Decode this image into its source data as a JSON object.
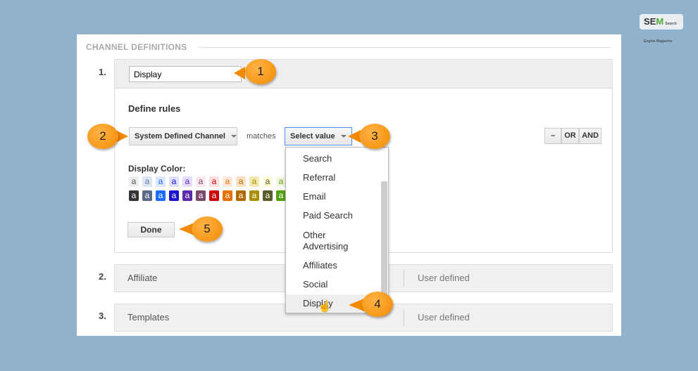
{
  "logo": {
    "brand": "SEM",
    "sub": "Search Engine Magazine"
  },
  "section_title": "CHANNEL DEFINITIONS",
  "rows": [
    {
      "number": "1.",
      "name": "Display"
    },
    {
      "number": "2.",
      "name": "Affiliate",
      "type": "User defined"
    },
    {
      "number": "3.",
      "name": "Templates",
      "type": "User defined"
    }
  ],
  "rules": {
    "title": "Define rules",
    "dimension": "System Defined Channel",
    "operator": "matches",
    "value_placeholder": "Select value",
    "minus": "–",
    "or": "OR",
    "and": "AND"
  },
  "display_color": {
    "label": "Display Color:",
    "swatch_letter": "a",
    "light": [
      [
        "#eeeeee",
        "#555"
      ],
      [
        "#dde6f2",
        "#6a7a96"
      ],
      [
        "#dde8ff",
        "#1a6cff"
      ],
      [
        "#dde0ff",
        "#1a12cc"
      ],
      [
        "#e4dcff",
        "#5a2aa8"
      ],
      [
        "#fbe8ee",
        "#7a4a6a"
      ],
      [
        "#fde0e0",
        "#cc0000"
      ],
      [
        "#fde9dc",
        "#e87000"
      ],
      [
        "#fbe0c5",
        "#b06a00"
      ],
      [
        "#f0e8b0",
        "#aa9000"
      ],
      [
        "#fcfcd8",
        "#5a5a2a"
      ],
      [
        "#f3f8e0",
        "#55a010"
      ]
    ],
    "dark": [
      "#333333",
      "#5a6a86",
      "#1a6cff",
      "#1a12cc",
      "#5a2aa8",
      "#7a4a6a",
      "#cc0000",
      "#e87000",
      "#b06a00",
      "#aa9000",
      "#5a5a2a",
      "#55a010"
    ]
  },
  "done_label": "Done",
  "dropdown": [
    "Search",
    "Referral",
    "Email",
    "Paid Search",
    "Other Advertising",
    "Affiliates",
    "Social",
    "Display"
  ],
  "callouts": [
    "1",
    "2",
    "3",
    "4",
    "5"
  ],
  "accent": "#f28a00"
}
